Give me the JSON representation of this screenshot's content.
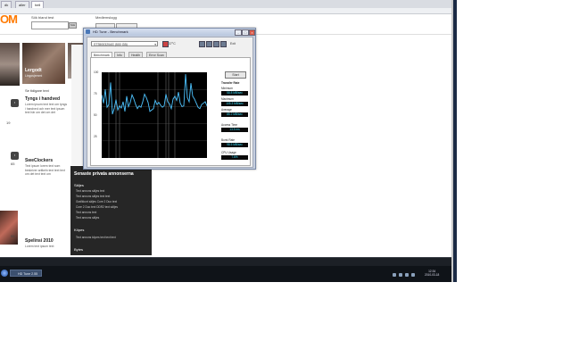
{
  "browser": {
    "tabs": [
      "dk",
      "aller",
      "hell"
    ]
  },
  "site": {
    "logo_text": "OM",
    "search_label": "Sök bland test",
    "search_button": "Sök",
    "member_label": "Medlemslogg",
    "articles": [
      {
        "title": "Lergodt",
        "text": "Lingosjemmt"
      },
      {
        "title": "Tyngs i handved",
        "text": "Lorem ipsum text text om tyngs i handved och mer text ipsum text här om det om det"
      },
      {
        "title": "SweClockers",
        "text": "Text ipsum lorem text som beskriver artikeln text text text om det text text om"
      },
      {
        "title": "Spelinsi 2010",
        "text": "Lorem text ipsum text"
      }
    ],
    "category_link": "Se tidigare text",
    "comment_counts": [
      "19",
      "65",
      "55"
    ]
  },
  "dark_panel": {
    "heading": "Senaste privata annonserna",
    "subheading": "Säljes",
    "lines": [
      "Text annons säljes text",
      "Text annons säljes text text",
      "Grafikkort säljes Core 2 Duo text",
      "Core 2 Duo text DDR2 text säljes",
      "Text annons text",
      "Text annons säljes"
    ],
    "heading2": "Köpes",
    "lines2": [
      "Text annons köpes text text text"
    ],
    "heading3": "Bytes"
  },
  "app": {
    "title": "HD Tune - Benchmark",
    "drive": "ST3500320AS (500 GB)",
    "toolbar_text": "37°C",
    "exit_label": "Exit",
    "tabs": [
      "Benchmark",
      "Info",
      "Health",
      "Error Scan"
    ],
    "start_button": "Start",
    "stats": [
      {
        "label": "Transfer Rate",
        "value": ""
      },
      {
        "label": "Minimum",
        "value": "58.8 MB/sec"
      },
      {
        "label": "Maximum",
        "value": "105.3 MB/sec"
      },
      {
        "label": "Average",
        "value": "85.2 MB/sec"
      },
      {
        "label": "Access Time",
        "value": "13.5 ms"
      },
      {
        "label": "Burst Rate",
        "value": "98.5 MB/sec"
      },
      {
        "label": "CPU Usage",
        "value": "7.6%"
      }
    ],
    "y_ticks": [
      "100",
      "75",
      "50",
      "25"
    ]
  },
  "taskbar": {
    "task_label": "HD Tune 2.55",
    "clock_time": "12:34",
    "clock_date": "2010-03-18"
  },
  "chart_data": {
    "type": "line",
    "title": "",
    "xlabel": "",
    "ylabel": "MB/sec",
    "ylim": [
      0,
      125
    ],
    "series": [
      {
        "values": [
          92,
          80,
          100,
          74,
          78,
          110,
          64,
          72,
          85,
          70,
          76,
          73,
          82,
          68,
          90,
          75,
          81,
          92,
          86,
          78,
          72,
          76,
          74,
          82,
          93,
          88,
          81,
          68,
          70,
          72,
          84,
          78,
          81,
          77,
          74,
          76,
          93,
          82,
          79,
          72,
          86,
          90,
          84,
          96,
          80,
          75,
          76,
          122,
          88,
          82,
          109,
          90,
          86,
          80,
          74,
          72,
          78,
          80,
          82,
          76
        ]
      }
    ]
  }
}
